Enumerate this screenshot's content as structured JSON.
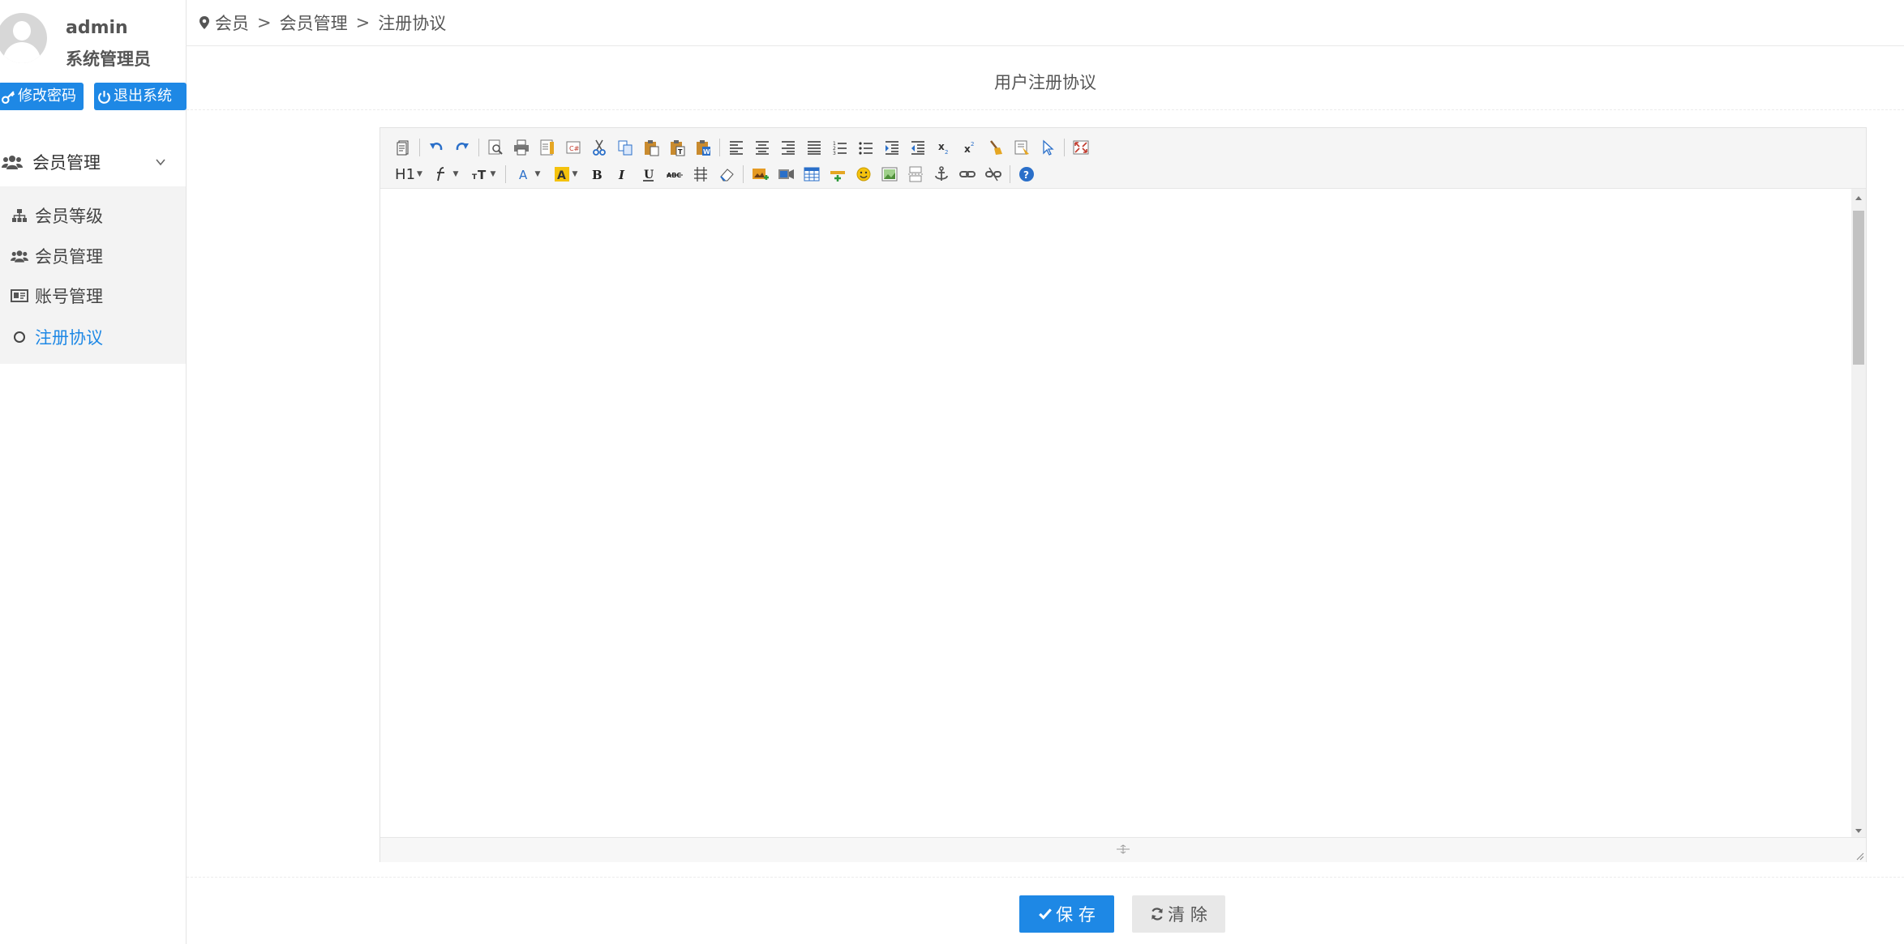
{
  "user": {
    "name": "admin",
    "role": "系统管理员",
    "change_password_label": "修改密码",
    "logout_label": "退出系统"
  },
  "breadcrumb": {
    "items": [
      "会员",
      "会员管理",
      "注册协议"
    ],
    "separator": ">"
  },
  "sidebar": {
    "group_label": "会员管理",
    "group_icon": "users-icon",
    "items": [
      {
        "label": "会员等级",
        "icon": "sitemap-icon"
      },
      {
        "label": "会员管理",
        "icon": "users-icon"
      },
      {
        "label": "账号管理",
        "icon": "id-card-icon"
      },
      {
        "label": "注册协议",
        "icon": "circle-icon",
        "active": true
      }
    ]
  },
  "page": {
    "title": "用户注册协议"
  },
  "editor": {
    "toolbar_row1": [
      "source",
      "undo",
      "redo",
      "preview",
      "print",
      "template",
      "code",
      "cut",
      "copy",
      "paste",
      "paste-text",
      "paste-word",
      "align-left",
      "align-center",
      "align-right",
      "align-justify",
      "ordered-list",
      "unordered-list",
      "indent",
      "outdent",
      "subscript",
      "superscript",
      "clear-format",
      "select-all",
      "fullscreen"
    ],
    "toolbar_row2": [
      "heading",
      "font-family",
      "font-size",
      "font-color",
      "highlight",
      "bold",
      "italic",
      "underline",
      "strikethrough",
      "line-height",
      "remove-format",
      "image",
      "flash",
      "table",
      "horizontal-rule",
      "emoticon",
      "image-manager",
      "page-break",
      "anchor",
      "link",
      "unlink",
      "help"
    ],
    "heading_label": "H1",
    "content": ""
  },
  "actions": {
    "save_label": "保 存",
    "clear_label": "清 除"
  },
  "colors": {
    "primary": "#1e88e5",
    "sidebar_submenu_bg": "#f3f3f3",
    "toolbar_bg": "#f5f5f5"
  }
}
